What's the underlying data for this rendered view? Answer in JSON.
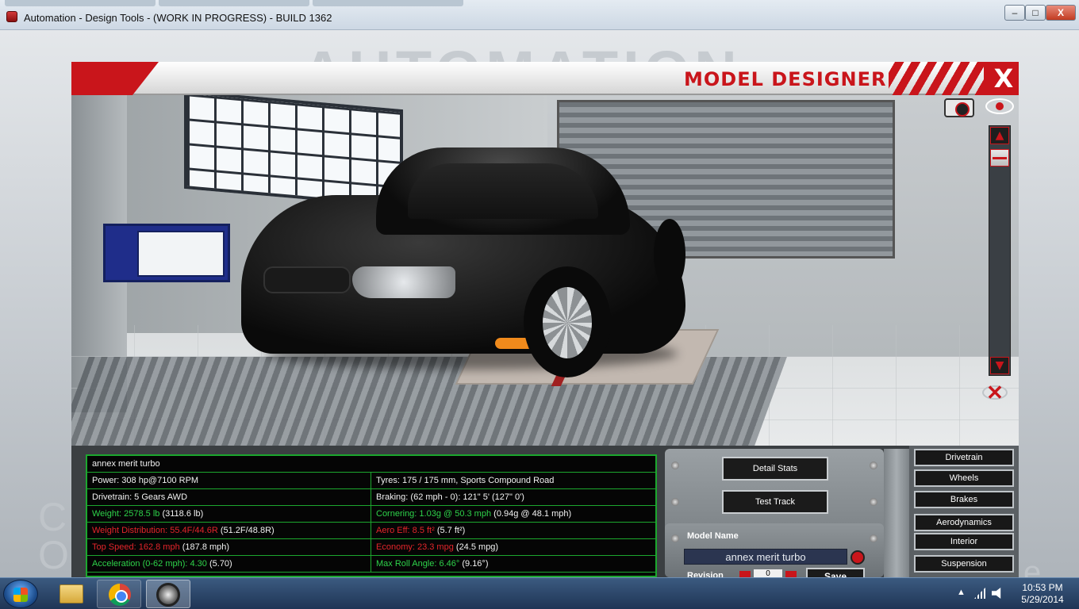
{
  "window": {
    "title": "Automation - Design Tools - (WORK IN PROGRESS) - BUILD 1362",
    "controls": {
      "minimize": "–",
      "maximize": "□",
      "close": "X"
    }
  },
  "background": {
    "wordmark": "AUTOMATION"
  },
  "panel": {
    "title": "MODEL DESIGNER",
    "close_label": "X"
  },
  "viewport": {
    "icons": [
      "camera-icon",
      "eye-icon",
      "hide-eye-icon"
    ],
    "scroll_up": "▲",
    "scroll_down": "▼"
  },
  "stats": {
    "name": "annex merit turbo",
    "power": "Power: 308 hp@7100 RPM",
    "tyres": "Tyres: 175 / 175 mm, Sports Compound Road",
    "drivetrain": "Drivetrain: 5 Gears AWD",
    "braking": "Braking: (62 mph - 0): 121\" 5' (127\" 0')",
    "weight": "Weight: 2578.5 lb",
    "weight_alt": " (3118.6 lb)",
    "cornering": "Cornering: 1.03g @ 50.3 mph",
    "cornering_alt": " (0.94g @ 48.1 mph)",
    "weight_dist": "Weight Distribution: 55.4F/44.6R",
    "weight_dist_alt": " (51.2F/48.8R)",
    "aero": "Aero Eff: 8.5 ft²",
    "aero_alt": " (5.7 ft²)",
    "top_speed": "Top Speed: 162.8 mph",
    "top_speed_alt": " (187.8 mph)",
    "economy": "Economy: 23.3 mpg",
    "economy_alt": " (24.5 mpg)",
    "acceleration": "Acceleration (0-62 mph): 4.30",
    "acceleration_alt": " (5.70)",
    "roll": "Max Roll Angle: 6.46°",
    "roll_alt": " (9.16°)"
  },
  "controls": {
    "detail_stats": "Detail Stats",
    "test_track": "Test Track",
    "model_name_label": "Model Name",
    "model_name_value": "annex merit turbo",
    "revision_label": "Revision",
    "revision_value": "0",
    "save": "Save"
  },
  "nav": [
    "Drivetrain",
    "Wheels",
    "Brakes",
    "Aerodynamics",
    "Interior",
    "Suspension"
  ],
  "taskbar": {
    "time": "10:53 PM",
    "date": "5/29/2014",
    "tray_arrow": "▲"
  }
}
